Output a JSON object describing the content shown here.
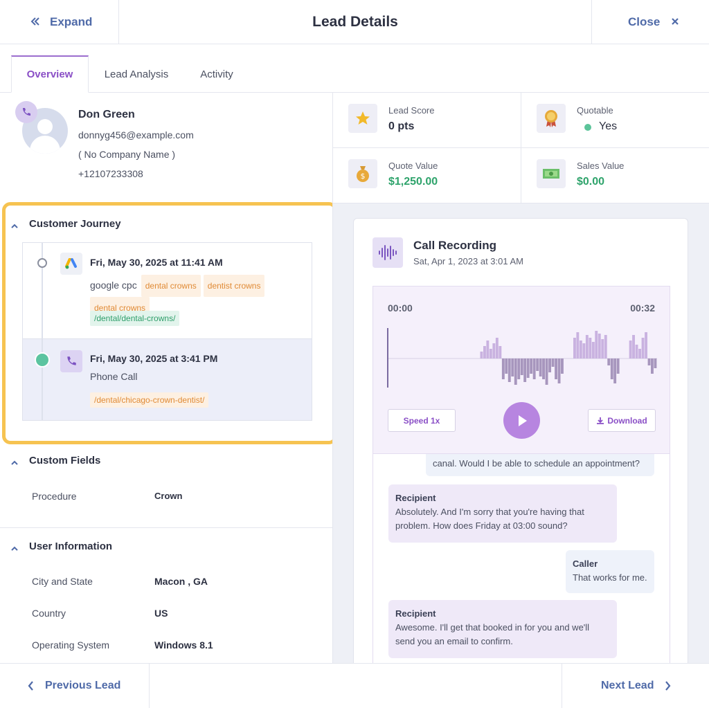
{
  "header": {
    "expand_label": "Expand",
    "title": "Lead Details",
    "close_label": "Close"
  },
  "tabs": [
    {
      "label": "Overview",
      "active": true
    },
    {
      "label": "Lead Analysis",
      "active": false
    },
    {
      "label": "Activity",
      "active": false
    }
  ],
  "contact": {
    "name": "Don Green",
    "email": "donnyg456@example.com",
    "company": "( No Company Name )",
    "phone": "+12107233308"
  },
  "stats": {
    "lead_score": {
      "label": "Lead Score",
      "value": "0 pts"
    },
    "quotable": {
      "label": "Quotable",
      "value": "Yes"
    },
    "quote_value": {
      "label": "Quote Value",
      "value": "$1,250.00"
    },
    "sales_value": {
      "label": "Sales Value",
      "value": "$0.00"
    }
  },
  "journey": {
    "title": "Customer Journey",
    "events": [
      {
        "datetime": "Fri, May 30, 2025 at 11:41 AM",
        "source": "google cpc",
        "keywords": [
          "dental crowns",
          "dentist crowns",
          "dental crowns"
        ],
        "path": "/dental/dental-crowns/"
      },
      {
        "datetime": "Fri, May 30, 2025 at 3:41 PM",
        "source": "Phone Call",
        "path": "/dental/chicago-crown-dentist/"
      }
    ]
  },
  "custom_fields": {
    "title": "Custom Fields",
    "rows": [
      {
        "label": "Procedure",
        "value": "Crown"
      }
    ]
  },
  "user_info": {
    "title": "User Information",
    "rows": [
      {
        "label": "City and State",
        "value": "Macon , GA"
      },
      {
        "label": "Country",
        "value": "US"
      },
      {
        "label": "Operating System",
        "value": "Windows 8.1"
      }
    ]
  },
  "recording": {
    "title": "Call Recording",
    "date": "Sat, Apr 1, 2023 at 3:01 AM",
    "time_start": "00:00",
    "time_end": "00:32",
    "speed_label": "Speed 1x",
    "download_label": "Download",
    "progress": 0.0
  },
  "transcript": [
    {
      "speaker": "",
      "text": "canal. Would I be able to schedule an appointment?",
      "side": "right"
    },
    {
      "speaker": "Recipient",
      "text": "Absolutely. And I'm sorry that you're having that problem. How does Friday at 03:00 sound?",
      "side": "left"
    },
    {
      "speaker": "Caller",
      "text": "That works for me.",
      "side": "right"
    },
    {
      "speaker": "Recipient",
      "text": "Awesome. I'll get that booked in for you and we'll send you an email to confirm.",
      "side": "left"
    }
  ],
  "footer": {
    "prev_label": "Previous Lead",
    "next_label": "Next Lead"
  },
  "colors": {
    "accent": "#4f6aa8",
    "purple": "#9b6dce",
    "highlight": "#f6c351",
    "green": "#2ea36b"
  }
}
